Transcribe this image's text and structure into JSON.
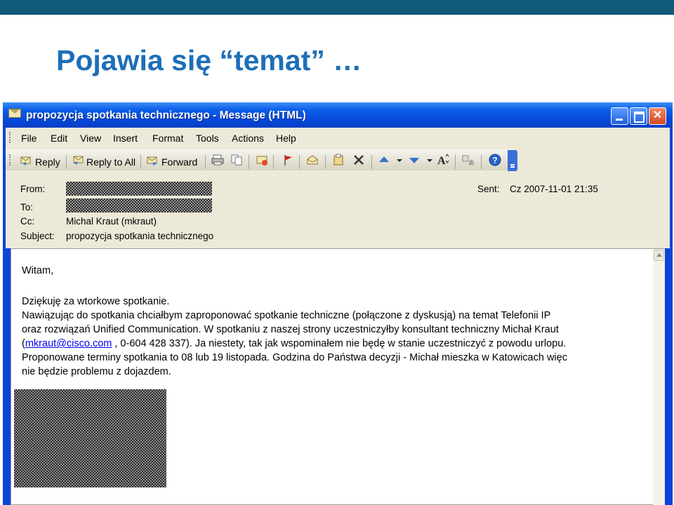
{
  "slide": {
    "title": "Pojawia się “temat” …"
  },
  "window": {
    "title": "propozycja spotkania technicznego - Message (HTML)"
  },
  "menu": [
    "File",
    "Edit",
    "View",
    "Insert",
    "Format",
    "Tools",
    "Actions",
    "Help"
  ],
  "toolbar": {
    "reply": "Reply",
    "reply_all": "Reply to All",
    "forward": "Forward"
  },
  "header": {
    "from_label": "From:",
    "to_label": "To:",
    "cc_label": "Cc:",
    "cc_value": "Michal Kraut (mkraut)",
    "subject_label": "Subject:",
    "subject_value": "propozycja spotkania technicznego",
    "sent_label": "Sent:",
    "sent_value": "Cz 2007-11-01 21:35"
  },
  "message": {
    "greeting": "Witam,",
    "line1": "Dziękuję za wtorkowe spotkanie.",
    "line2": "Nawiązując do spotkania chciałbym zaproponować spotkanie techniczne (połączone z dyskusją) na temat Telefonii IP",
    "line3": "oraz rozwiązań Unified Communication. W spotkaniu z naszej strony uczestniczyłby konsultant techniczny Michał Kraut",
    "line4_open": "(",
    "email": "mkraut@cisco.com",
    "line4_rest": " , 0-604 428 337). Ja niestety, tak jak wspominałem nie będę w stanie uczestniczyć z powodu urlopu.",
    "line5": "Proponowane terminy spotkania to 08 lub 19 listopada. Godzina do Państwa decyzji - Michał mieszka w Katowicach więc",
    "line6": "nie będzie problemu z dojazdem."
  }
}
